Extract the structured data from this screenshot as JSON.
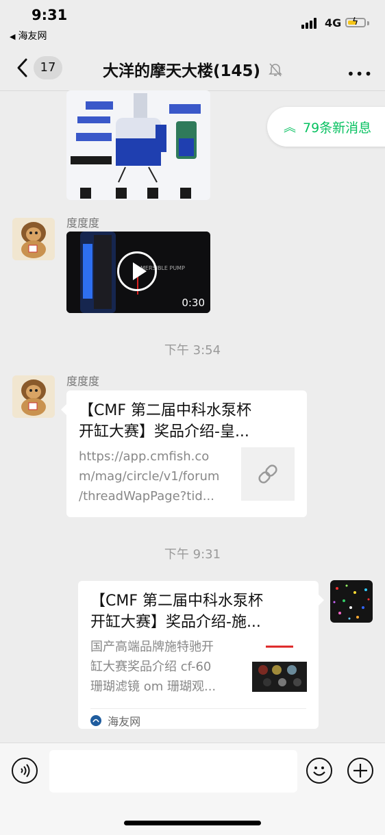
{
  "status_bar": {
    "time": "9:31",
    "back_app": "海友网",
    "network": "4G"
  },
  "nav": {
    "unread_count": "17",
    "title": "大洋的摩天大楼(145)",
    "more_label": "•••"
  },
  "new_messages_pill": {
    "text": "79条新消息"
  },
  "messages": [
    {
      "sender": "",
      "type": "image"
    },
    {
      "sender": "度度度",
      "type": "video",
      "duration": "0:30"
    },
    {
      "timestamp": "下午 3:54"
    },
    {
      "sender": "度度度",
      "type": "link",
      "title_line1": "【CMF 第二届中科水泵杯",
      "title_line2": "开缸大赛】奖品介绍-皇...",
      "desc_line1": "https://app.cmfish.co",
      "desc_line2": "m/mag/circle/v1/forum",
      "desc_line3": "/threadWapPage?tid..."
    },
    {
      "timestamp": "下午 9:31"
    },
    {
      "sender": "self",
      "type": "link",
      "title_line1": "【CMF 第二届中科水泵杯",
      "title_line2": "开缸大赛】奖品介绍-施...",
      "desc_line1": "国产高端品牌施特驰开",
      "desc_line2": "缸大赛奖品介绍 cf-60",
      "desc_line3": "珊瑚滤镜 om 珊瑚观...",
      "source": "海友网"
    }
  ],
  "colors": {
    "accent": "#07c160",
    "background": "#ededed",
    "card": "#ffffff"
  },
  "icons": {
    "back": "chevron-left-icon",
    "mute": "bell-off-icon",
    "voice": "voice-icon",
    "emoji": "emoji-icon",
    "add": "plus-icon",
    "link": "link-icon",
    "play": "play-icon"
  }
}
